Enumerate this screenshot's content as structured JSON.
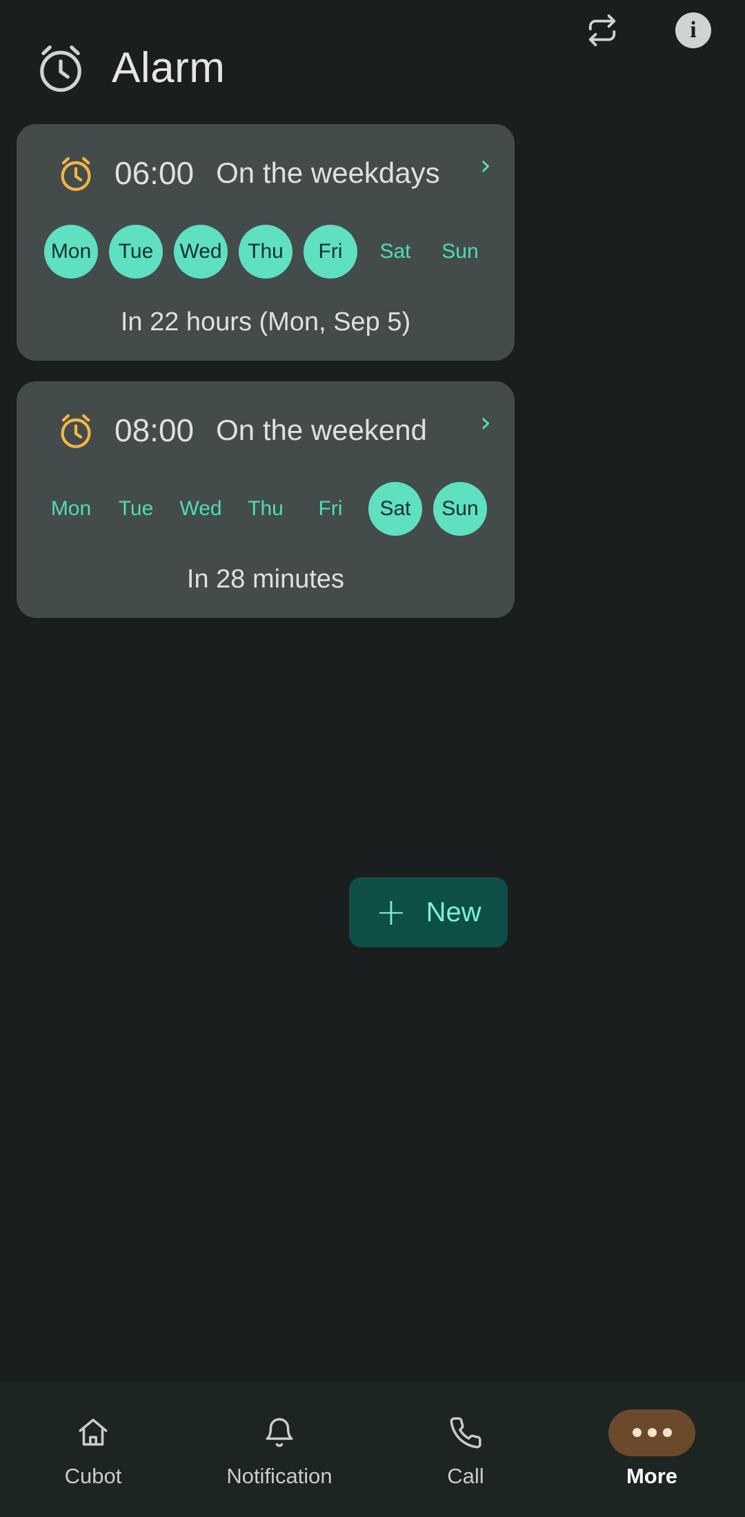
{
  "topbar": {
    "sync_icon": "sync-icon",
    "info_icon": "info-icon",
    "info_glyph": "i"
  },
  "header": {
    "title": "Alarm",
    "icon": "alarm-clock-icon"
  },
  "alarms": [
    {
      "icon": "alarm-clock-icon",
      "time": "06:00",
      "label": "On the weekdays",
      "chevron": "›",
      "days": [
        {
          "label": "Mon",
          "on": true
        },
        {
          "label": "Tue",
          "on": true
        },
        {
          "label": "Wed",
          "on": true
        },
        {
          "label": "Thu",
          "on": true
        },
        {
          "label": "Fri",
          "on": true
        },
        {
          "label": "Sat",
          "on": false
        },
        {
          "label": "Sun",
          "on": false
        }
      ],
      "next": "In 22 hours (Mon, Sep 5)"
    },
    {
      "icon": "alarm-clock-icon",
      "time": "08:00",
      "label": "On the weekend",
      "chevron": "›",
      "days": [
        {
          "label": "Mon",
          "on": false
        },
        {
          "label": "Tue",
          "on": false
        },
        {
          "label": "Wed",
          "on": false
        },
        {
          "label": "Thu",
          "on": false
        },
        {
          "label": "Fri",
          "on": false
        },
        {
          "label": "Sat",
          "on": true
        },
        {
          "label": "Sun",
          "on": true
        }
      ],
      "next": "In 28 minutes"
    }
  ],
  "fab": {
    "plus": "+",
    "label": "New"
  },
  "navbar": {
    "items": [
      {
        "label": "Cubot",
        "icon": "home-icon",
        "active": false
      },
      {
        "label": "Notification",
        "icon": "bell-icon",
        "active": false
      },
      {
        "label": "Call",
        "icon": "phone-icon",
        "active": false
      },
      {
        "label": "More",
        "icon": "more-dots-icon",
        "active": true
      }
    ]
  },
  "colors": {
    "background": "#1b1e1e",
    "card": "#434c4a",
    "accent_teal": "#5fe0c0",
    "accent_orange": "#f5b445",
    "fab_bg": "#0d4f47",
    "nav_bg": "#1d2523",
    "more_pill": "#6b4a2c"
  }
}
